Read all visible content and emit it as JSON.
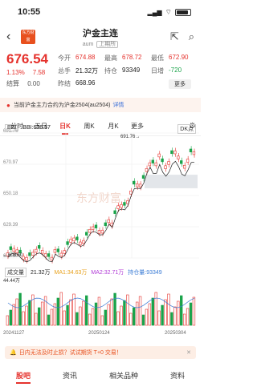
{
  "status": {
    "time": "10:55"
  },
  "nav": {
    "logo_text": "东方财富",
    "title": "沪金主连",
    "code": "aum",
    "period_tag": "上期所"
  },
  "quote": {
    "price": "676.54",
    "change_pct": "1.13%",
    "change": "7.58",
    "settle_label": "结算",
    "settle_value": "0.00",
    "stats": [
      {
        "label": "今开",
        "value": "674.88",
        "color": "red"
      },
      {
        "label": "最高",
        "value": "678.72",
        "color": "red"
      },
      {
        "label": "最低",
        "value": "672.90",
        "color": "red"
      },
      {
        "label": "总手",
        "value": "21.32万",
        "color": "plain"
      },
      {
        "label": "持仓",
        "value": "93349",
        "color": "plain"
      },
      {
        "label": "日增",
        "value": "-720",
        "color": "green"
      },
      {
        "label": "昨结",
        "value": "668.96",
        "color": "plain"
      }
    ],
    "more_label": "更多"
  },
  "notice": {
    "text": "当前沪金主力合约为沪金2504(au2504)",
    "link": "详情"
  },
  "ktabs": {
    "tabs": [
      "分时",
      "五日",
      "日K",
      "周K",
      "月K",
      "更多"
    ],
    "active": 2
  },
  "indicators": {
    "main_select": "BBI",
    "main_value": "BBI:676.57",
    "dk_label": "DK点",
    "vol_select": "成交量",
    "vol_value": "21.32万",
    "ma1": "MA1:34.63万",
    "ma2": "MA2:32.71万",
    "oi": "持仓量:93349",
    "vol_max": "44.44万"
  },
  "chart_data": {
    "type": "candlestick",
    "y_ticks": [
      "691.76",
      "670.97",
      "650.18",
      "629.39",
      "608.60"
    ],
    "ylim": [
      608.6,
      691.76
    ],
    "high_label": "691.76",
    "low_label": "608.60",
    "dates": [
      "20241127",
      "20250124",
      "20250304"
    ],
    "watermark": "东方财富"
  },
  "bottom_banner": {
    "text": "日内无法及时止损？试试期货 T+0 交易！"
  },
  "bottom_tabs": [
    "股吧",
    "资讯",
    "相关品种",
    "资料"
  ]
}
